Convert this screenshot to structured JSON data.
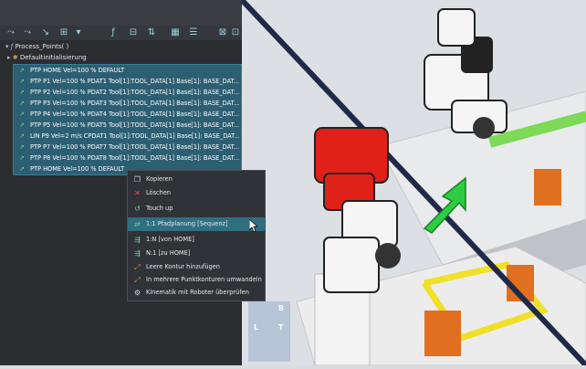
{
  "tree": {
    "root_label": "Process_Points( )",
    "init_label": "Defaultinitialisierung",
    "items": [
      "PTP HOME Vel=100 % DEFAULT",
      "PTP P1 Vel=100 % PDAT1 Tool[1]:TOOL_DATA[1] Base[1]: BASE_DAT...",
      "PTP P2 Vel=100 % PDAT2 Tool[1]:TOOL_DATA[1] Base[1]: BASE_DAT...",
      "PTP P3 Vel=100 % PDAT3 Tool[1]:TOOL_DATA[1] Base[1]: BASE_DAT...",
      "PTP P4 Vel=100 % PDAT4 Tool[1]:TOOL_DATA[1] Base[1]: BASE_DAT...",
      "PTP P5 Vel=100 % PDAT5 Tool[1]:TOOL_DATA[1] Base[1]: BASE_DAT...",
      "LIN P9 Vel=2 m/s CPDAT1 Tool[1]:TOOL_DATA[1] Base[1]: BASE_DAT...",
      "PTP P7 Vel=100 % PDAT7 Tool[1]:TOOL_DATA[1] Base[1]: BASE_DAT...",
      "PTP P8 Vel=100 % PDAT8 Tool[1]:TOOL_DATA[1] Base[1]: BASE_DAT...",
      "PTP HOME Vel=100 % DEFAULT"
    ]
  },
  "context_menu": {
    "items": [
      {
        "label": "Kopieren",
        "icon": "copy-icon"
      },
      {
        "label": "Löschen",
        "icon": "delete-icon"
      },
      {
        "label": "Touch up",
        "icon": "touch-up-icon"
      },
      {
        "label": "1:1 Pfadplanung [Sequenz]",
        "icon": "path-planning-icon"
      },
      {
        "label": "1:N [von HOME]",
        "icon": "one-to-n-icon"
      },
      {
        "label": "N:1 [zu HOME]",
        "icon": "n-to-one-icon"
      },
      {
        "label": "Leere Kontur hinzufügen",
        "icon": "add-contour-icon"
      },
      {
        "label": "In mehrere Punktkonturen umwandeln",
        "icon": "convert-contours-icon"
      },
      {
        "label": "Kinematik mit Roboter überprüfen",
        "icon": "kinematics-icon"
      }
    ]
  },
  "nav_cube": {
    "labels": [
      "L",
      "T",
      "B"
    ]
  },
  "colors": {
    "selection": "#2d5f73",
    "highlight": "#2f6f80",
    "robot_red": "#e0211a",
    "arrow_green": "#2ecc40"
  }
}
